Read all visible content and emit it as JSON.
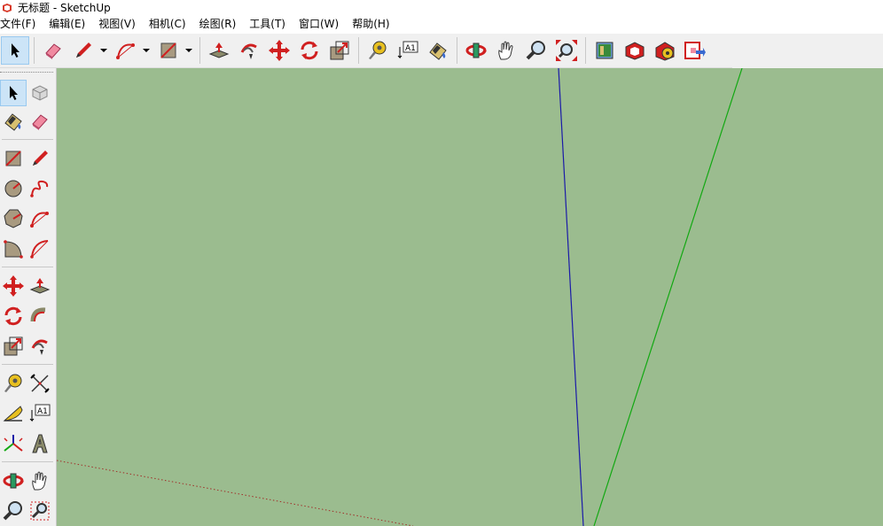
{
  "window": {
    "title": "无标题 - SketchUp"
  },
  "menu": [
    "文件(F)",
    "编辑(E)",
    "视图(V)",
    "相机(C)",
    "绘图(R)",
    "工具(T)",
    "窗口(W)",
    "帮助(H)"
  ],
  "colors": {
    "viewport_bg": "#9bbc8f",
    "axis_blue": "#1a1aa8",
    "axis_green": "#12a812",
    "axis_red": "#a0302a",
    "accent_red": "#d02020"
  },
  "toolbar": {
    "icons": [
      "select-icon",
      "eraser-icon",
      "pencil-icon",
      "arc-icon",
      "rectangle-icon",
      "push-pull-icon",
      "follow-me-icon",
      "move-icon",
      "rotate-icon",
      "scale-icon",
      "tape-measure-icon",
      "text-icon",
      "paint-bucket-icon",
      "orbit-icon",
      "pan-icon",
      "zoom-icon",
      "zoom-extents-icon",
      "warehouse-icon",
      "extension-icon",
      "model-info-icon",
      "export-icon"
    ]
  },
  "sidebar": {
    "icons": [
      "select-icon",
      "component-icon",
      "paint-bucket-icon",
      "eraser-icon",
      "rectangle-icon",
      "pencil-icon",
      "circle-icon",
      "freehand-icon",
      "polygon-icon",
      "arc-icon",
      "pie-icon",
      "arc3-icon",
      "move-icon",
      "push-pull-icon",
      "rotate-icon",
      "follow-me-icon",
      "scale-icon",
      "offset-icon",
      "tape-measure-icon",
      "dimension-icon",
      "protractor-icon",
      "text-icon",
      "axes-icon",
      "3d-text-icon",
      "orbit-icon",
      "pan-icon",
      "zoom-icon",
      "zoom-window-icon"
    ]
  }
}
